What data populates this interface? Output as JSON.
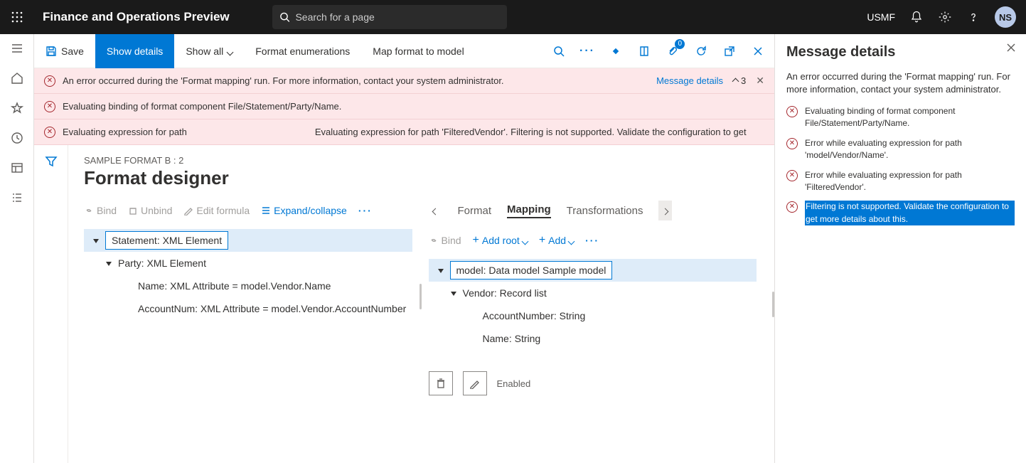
{
  "brand": "Finance and Operations Preview",
  "search_placeholder": "Search for a page",
  "company": "USMF",
  "avatar_initials": "NS",
  "toolbar": {
    "save": "Save",
    "show_details": "Show details",
    "show_all": "Show all",
    "format_enum": "Format enumerations",
    "map_format": "Map format to model"
  },
  "attachment_badge": "0",
  "errors": [
    {
      "text": "An error occurred during the 'Format mapping' run. For more information, contact your system administrator.",
      "link": "Message details",
      "count": "3"
    },
    {
      "text": "Evaluating binding of format component File/Statement/Party/Name."
    },
    {
      "text": "Evaluating expression for path",
      "extra": "Evaluating expression for path 'FilteredVendor'. Filtering is not supported. Validate the configuration to get"
    }
  ],
  "breadcrumb": "SAMPLE FORMAT B : 2",
  "page_title": "Format designer",
  "left_pane": {
    "bind": "Bind",
    "unbind": "Unbind",
    "edit_formula": "Edit formula",
    "expand": "Expand/collapse",
    "tree": [
      {
        "indent": 1,
        "selected": true,
        "text": "Statement: XML Element"
      },
      {
        "indent": 2,
        "text": "Party: XML Element"
      },
      {
        "indent": 3,
        "text": "Name: XML Attribute = model.Vendor.Name",
        "leaf": true
      },
      {
        "indent": 3,
        "text": "AccountNum: XML Attribute = model.Vendor.AccountNumber",
        "leaf": true
      }
    ]
  },
  "right_pane": {
    "tabs": {
      "format": "Format",
      "mapping": "Mapping",
      "transformations": "Transformations"
    },
    "bind": "Bind",
    "add_root": "Add root",
    "add": "Add",
    "tree": [
      {
        "indent": 1,
        "selected": true,
        "text": "model: Data model Sample model"
      },
      {
        "indent": 2,
        "text": "Vendor: Record list"
      },
      {
        "indent": 3,
        "text": "AccountNumber: String",
        "leaf": true
      },
      {
        "indent": 3,
        "text": "Name: String",
        "leaf": true
      }
    ],
    "param_label": "Enabled"
  },
  "details": {
    "title": "Message details",
    "summary": "An error occurred during the 'Format mapping' run. For more information, contact your system administrator.",
    "items": [
      {
        "text": "Evaluating binding of format component File/Statement/Party/Name."
      },
      {
        "text": "Error while evaluating expression for path 'model/Vendor/Name'."
      },
      {
        "text": "Error while evaluating expression for path 'FilteredVendor'."
      },
      {
        "text": "Filtering is not supported. Validate the configuration to get more details about this.",
        "selected": true
      }
    ]
  }
}
